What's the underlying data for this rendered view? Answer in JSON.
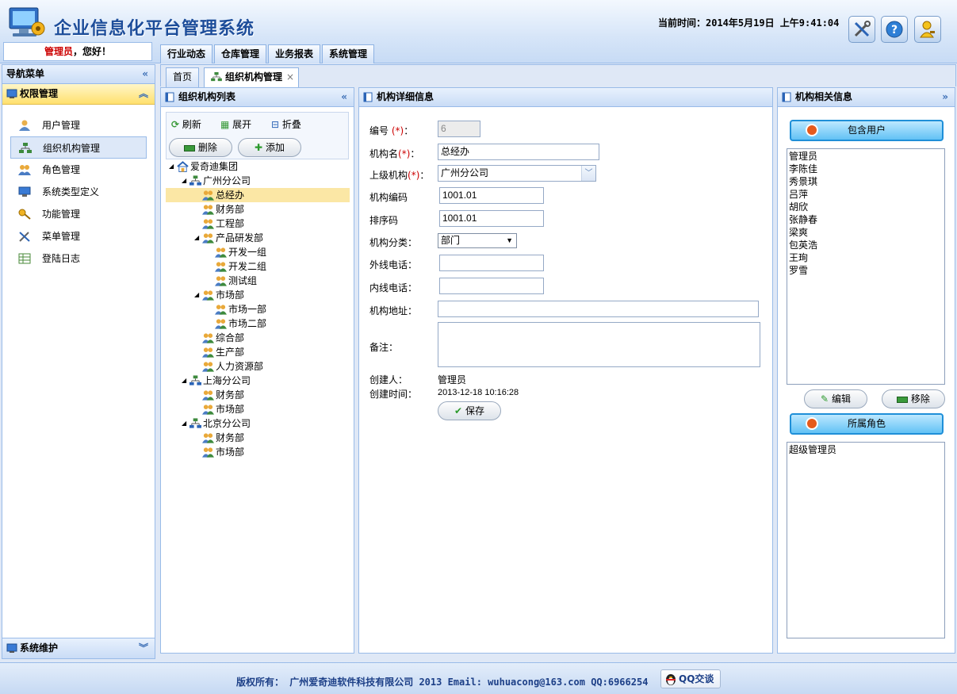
{
  "app": {
    "title": "企业信息化平台管理系统",
    "greeting_user": "管理员",
    "greeting_suffix": "，您好！",
    "clock": "当前时间：2014年5月19日 上午9:41:04"
  },
  "header_buttons": [
    {
      "icon": "tools-icon"
    },
    {
      "icon": "help-icon"
    },
    {
      "icon": "user-key-icon"
    }
  ],
  "top_tabs": [
    "行业动态",
    "仓库管理",
    "业务报表",
    "系统管理"
  ],
  "nav": {
    "title": "导航菜单",
    "section": "权限管理",
    "items": [
      "用户管理",
      "组织机构管理",
      "角色管理",
      "系统类型定义",
      "功能管理",
      "菜单管理",
      "登陆日志"
    ],
    "footer": "系统维护"
  },
  "content_tabs": {
    "home": "首页",
    "active": "组织机构管理",
    "close": "×"
  },
  "tree_panel": {
    "title": "组织机构列表",
    "refresh": "刷新",
    "expand": "展开",
    "collapse": "折叠",
    "delete": "删除",
    "add": "添加",
    "nodes": [
      {
        "label": "爱奇迪集团",
        "level": 0,
        "arrow": "◢",
        "icon": "home-icon"
      },
      {
        "label": "广州分公司",
        "level": 1,
        "arrow": "◢",
        "icon": "org-icon"
      },
      {
        "label": "总经办",
        "level": 2,
        "arrow": "",
        "icon": "group-icon",
        "selected": true
      },
      {
        "label": "财务部",
        "level": 2,
        "arrow": "",
        "icon": "group-icon"
      },
      {
        "label": "工程部",
        "level": 2,
        "arrow": "",
        "icon": "group-icon"
      },
      {
        "label": "产品研发部",
        "level": 2,
        "arrow": "◢",
        "icon": "group-icon"
      },
      {
        "label": "开发一组",
        "level": 3,
        "arrow": "",
        "icon": "group-icon"
      },
      {
        "label": "开发二组",
        "level": 3,
        "arrow": "",
        "icon": "group-icon"
      },
      {
        "label": "测试组",
        "level": 3,
        "arrow": "",
        "icon": "group-icon"
      },
      {
        "label": "市场部",
        "level": 2,
        "arrow": "◢",
        "icon": "group-icon"
      },
      {
        "label": "市场一部",
        "level": 3,
        "arrow": "",
        "icon": "group-icon"
      },
      {
        "label": "市场二部",
        "level": 3,
        "arrow": "",
        "icon": "group-icon"
      },
      {
        "label": "综合部",
        "level": 2,
        "arrow": "",
        "icon": "group-icon"
      },
      {
        "label": "生产部",
        "level": 2,
        "arrow": "",
        "icon": "group-icon"
      },
      {
        "label": "人力资源部",
        "level": 2,
        "arrow": "",
        "icon": "group-icon"
      },
      {
        "label": "上海分公司",
        "level": 1,
        "arrow": "◢",
        "icon": "org-icon"
      },
      {
        "label": "财务部",
        "level": 2,
        "arrow": "",
        "icon": "group-icon"
      },
      {
        "label": "市场部",
        "level": 2,
        "arrow": "",
        "icon": "group-icon"
      },
      {
        "label": "北京分公司",
        "level": 1,
        "arrow": "◢",
        "icon": "org-icon"
      },
      {
        "label": "财务部",
        "level": 2,
        "arrow": "",
        "icon": "group-icon"
      },
      {
        "label": "市场部",
        "level": 2,
        "arrow": "",
        "icon": "group-icon"
      }
    ]
  },
  "detail_panel": {
    "title": "机构详细信息",
    "labels": {
      "id": "编号",
      "name": "机构名",
      "parent": "上级机构",
      "code": "机构编码",
      "sort": "排序码",
      "category": "机构分类：",
      "ext_phone": "外线电话：",
      "int_phone": "内线电话：",
      "address": "机构地址：",
      "remark": "备注：",
      "creator": "创建人：",
      "created": "创建时间："
    },
    "req_mark": "(*)",
    "colon": "：",
    "values": {
      "id": "6",
      "name": "总经办",
      "parent": "广州分公司",
      "code": "1001.01",
      "sort": "1001.01",
      "category": "部门",
      "ext_phone": "",
      "int_phone": "",
      "address": "",
      "remark": "",
      "creator": "管理员",
      "created": "2013-12-18 10:16:28"
    },
    "save": "保存"
  },
  "relation_panel": {
    "title": "机构相关信息",
    "users_button": "包含用户",
    "users": [
      "管理员",
      "李陈佳",
      "秀景琪",
      "吕萍",
      "胡欣",
      "张静春",
      "梁爽",
      "包英浩",
      "王珣",
      "罗雪"
    ],
    "edit": "编辑",
    "remove": "移除",
    "roles_button": "所属角色",
    "roles": [
      "超级管理员"
    ]
  },
  "footer": {
    "text": "版权所有：  广州爱奇迪软件科技有限公司 2013 Email: wuhuacong@163.com QQ:6966254",
    "qq": "QQ交谈"
  }
}
